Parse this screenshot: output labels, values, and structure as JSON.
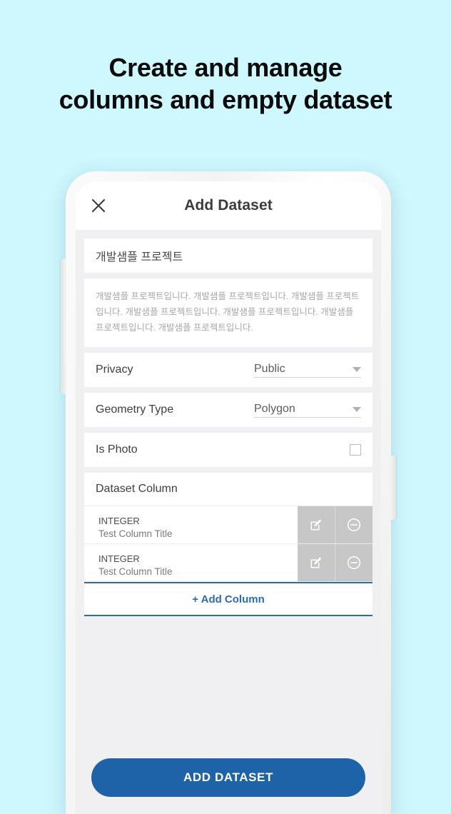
{
  "promo": {
    "line1": "Create and manage",
    "line2": "columns and empty dataset"
  },
  "app_bar": {
    "close_icon": "close-icon",
    "title": "Add Dataset"
  },
  "form": {
    "dataset_title": "개발샘플 프로젝트",
    "dataset_title_placeholder": "개발샘플 프로젝트",
    "dataset_description": "개발샘플 프로젝트입니다. 개발샘플 프로젝트입니다. 개발샘플 프로젝트입니다. 개발샘플 프로젝트입니다. 개발샘플 프로젝트입니다. 개발샘플 프로젝트입니다. 개발샘플 프로젝트입니다.",
    "privacy": {
      "label": "Privacy",
      "value": "Public",
      "caret_icon": "chevron-down-icon"
    },
    "geometry_type": {
      "label": "Geometry Type",
      "value": "Polygon",
      "caret_icon": "chevron-down-icon"
    },
    "is_photo": {
      "label": "Is Photo",
      "checked": false
    }
  },
  "dataset_column": {
    "header": "Dataset Column",
    "rows": [
      {
        "type": "INTEGER",
        "title": "Test Column Title",
        "edit_icon": "edit-pencil-icon",
        "remove_icon": "minus-circle-icon"
      },
      {
        "type": "INTEGER",
        "title": "Test Column Title",
        "edit_icon": "edit-pencil-icon",
        "remove_icon": "minus-circle-icon"
      }
    ],
    "add_column_label": "+ Add Column"
  },
  "cta": {
    "label": "ADD DATASET"
  },
  "colors": {
    "page_background": "#cef7fe",
    "accent_blue": "#2d6ca8",
    "cta_blue": "#1e63a8",
    "screen_background": "#f0f0f2",
    "action_gray": "#c7c7c7"
  }
}
